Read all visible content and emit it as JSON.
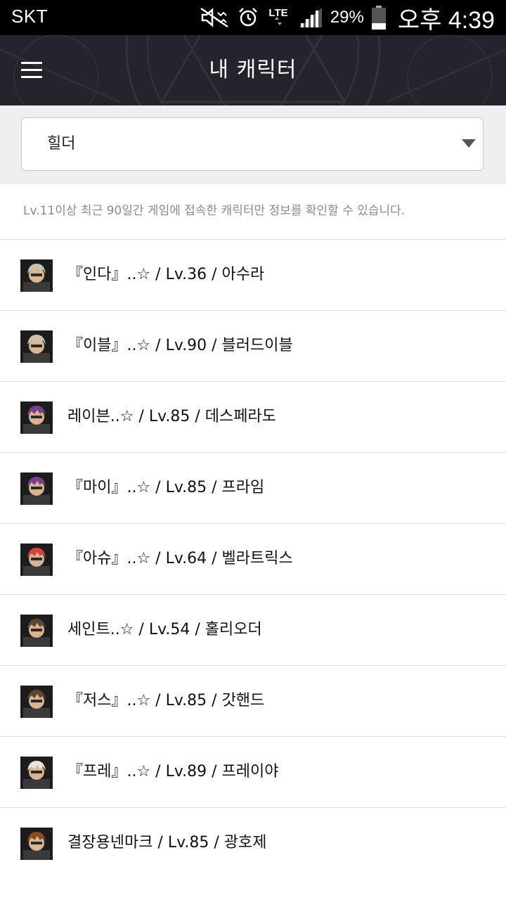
{
  "status_bar": {
    "carrier": "SKT",
    "network": "LTE",
    "battery": "29%",
    "time": "오후 4:39",
    "icons": [
      "mute-icon",
      "alarm-icon",
      "lte-icon",
      "signal-icon",
      "battery-icon"
    ]
  },
  "header": {
    "title": "내 캐릭터",
    "menu_icon": "hamburger-icon"
  },
  "server_select": {
    "selected": "힐더"
  },
  "notice": "Lv.11이상 최근 90일간 게임에 접속한 캐릭터만 정보를 확인할 수 있습니다.",
  "characters": [
    {
      "text": "『인다』..☆ / Lv.36 / 아수라",
      "avatar": "male-slayer-goggles",
      "avatar_color": "#c9c2b3"
    },
    {
      "text": "『이블』..☆ / Lv.90 / 블러드이블",
      "avatar": "male-slayer-goggles",
      "avatar_color": "#c9c2b3"
    },
    {
      "text": "레이븐..☆ / Lv.85 / 데스페라도",
      "avatar": "male-gunner-purple",
      "avatar_color": "#7a3f8f"
    },
    {
      "text": "『마이』..☆ / Lv.85 / 프라임",
      "avatar": "male-gunner-purple",
      "avatar_color": "#7a3f8f"
    },
    {
      "text": "『아슈』..☆ / Lv.64 / 벨라트릭스",
      "avatar": "female-red-hair",
      "avatar_color": "#d8403a"
    },
    {
      "text": "세인트..☆ / Lv.54 / 홀리오더",
      "avatar": "male-priest-dark",
      "avatar_color": "#5a4636"
    },
    {
      "text": "『저스』..☆ / Lv.85 / 갓핸드",
      "avatar": "male-priest-dark",
      "avatar_color": "#5a4636"
    },
    {
      "text": "『프레』..☆ / Lv.89 / 프레이야",
      "avatar": "female-white-hair",
      "avatar_color": "#e8e4dc"
    },
    {
      "text": "결장용넨마크 / Lv.85 / 광호제",
      "avatar": "male-fighter-brown",
      "avatar_color": "#8a4a22"
    }
  ]
}
